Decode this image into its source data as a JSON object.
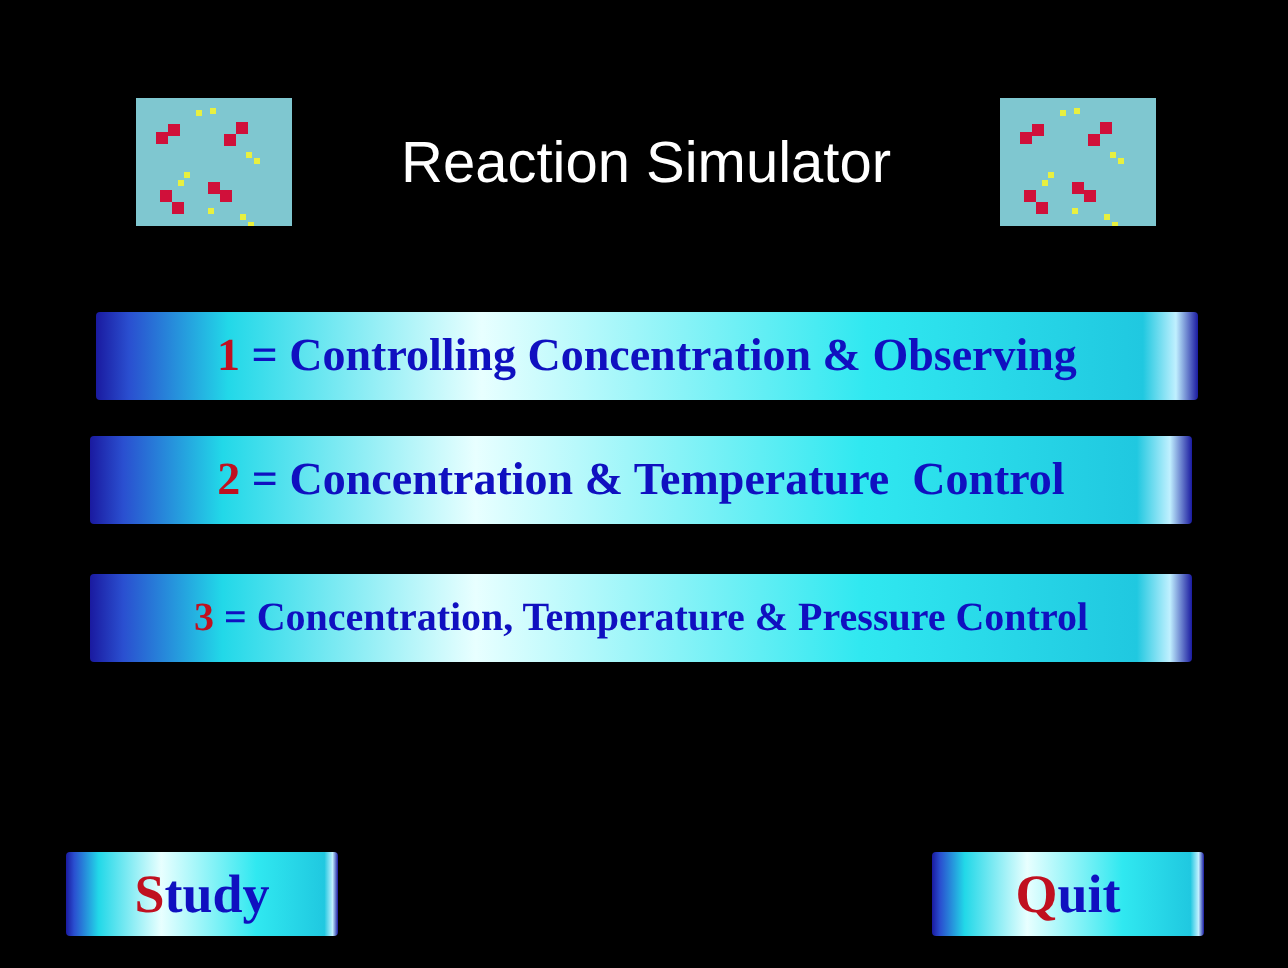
{
  "title": "Reaction Simulator",
  "menu": [
    {
      "key": "1",
      "label": "= Controlling Concentration & Observing"
    },
    {
      "key": "2",
      "label": "= Concentration & Temperature  Control"
    },
    {
      "key": "3",
      "label": "= Concentration, Temperature & Pressure Control"
    }
  ],
  "buttons": [
    {
      "hotkey": "S",
      "label": "tudy"
    },
    {
      "hotkey": "Q",
      "label": "uit"
    }
  ]
}
